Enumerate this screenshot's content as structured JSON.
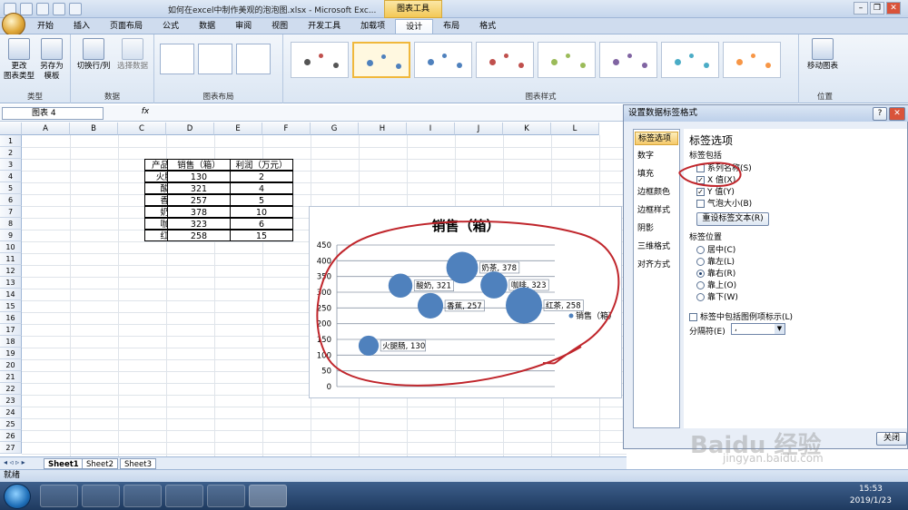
{
  "window": {
    "title": "如何在excel中制作美观的泡泡图.xlsx - Microsoft Exc...",
    "chart_tools_label": "图表工具"
  },
  "ribbon_tabs": [
    "开始",
    "插入",
    "页面布局",
    "公式",
    "数据",
    "审阅",
    "视图",
    "开发工具",
    "加载项",
    "设计",
    "布局",
    "格式"
  ],
  "active_tab": "设计",
  "ribbon": {
    "group_type": {
      "label": "类型",
      "btn_change": "更改\n图表类型",
      "btn_saveas": "另存为\n模板"
    },
    "group_data": {
      "label": "数据",
      "btn_switch": "切换行/列",
      "btn_select": "选择数据"
    },
    "group_layout": {
      "label": "图表布局"
    },
    "group_styles": {
      "label": "图表样式"
    },
    "group_location": {
      "label": "位置",
      "btn_move": "移动图表"
    }
  },
  "name_box": "图表 4",
  "fx_label": "fx",
  "columns": [
    "A",
    "B",
    "C",
    "D",
    "E",
    "F",
    "G",
    "H",
    "I",
    "J",
    "K",
    "L"
  ],
  "rows": [
    "1",
    "2",
    "3",
    "4",
    "5",
    "6",
    "7",
    "8",
    "9",
    "10",
    "11",
    "12",
    "13",
    "14",
    "15",
    "16",
    "17",
    "18",
    "19",
    "20",
    "21",
    "22",
    "23",
    "24",
    "25",
    "26",
    "27"
  ],
  "table": {
    "headers": [
      "产品名称",
      "销售（箱）",
      "利润（万元）"
    ],
    "rows": [
      [
        "火腿肠",
        "130",
        "2"
      ],
      [
        "酸奶",
        "321",
        "4"
      ],
      [
        "香蕉",
        "257",
        "5"
      ],
      [
        "奶茶",
        "378",
        "10"
      ],
      [
        "咖啡",
        "323",
        "6"
      ],
      [
        "红茶",
        "258",
        "15"
      ]
    ]
  },
  "chart_data": {
    "type": "scatter",
    "title": "销售（箱）",
    "ylim": [
      0,
      450
    ],
    "yticks": [
      "0",
      "50",
      "100",
      "150",
      "200",
      "250",
      "300",
      "350",
      "400",
      "450"
    ],
    "legend": "销售（箱）",
    "legend_position": "right",
    "grid": true,
    "points": [
      {
        "label": "火腿肠, 130",
        "y": 130,
        "size": 2
      },
      {
        "label": "酸奶, 321",
        "y": 321,
        "size": 4
      },
      {
        "label": "香蕉, 257",
        "y": 257,
        "size": 5
      },
      {
        "label": "奶茶, 378",
        "y": 378,
        "size": 10
      },
      {
        "label": "咖啡, 323",
        "y": 323,
        "size": 6
      },
      {
        "label": "红茶, 258",
        "y": 258,
        "size": 15
      }
    ],
    "color": "#4f81bd"
  },
  "sheet_tabs": [
    "Sheet1",
    "Sheet2",
    "Sheet3"
  ],
  "status": "就绪",
  "dialog": {
    "title": "设置数据标签格式",
    "nav": [
      "标签选项",
      "数字",
      "填充",
      "边框颜色",
      "边框样式",
      "阴影",
      "三维格式",
      "对齐方式"
    ],
    "selected_nav": "标签选项",
    "section_title": "标签选项",
    "contains_label": "标签包括",
    "checkboxes": [
      {
        "label": "系列名称(S)",
        "checked": false
      },
      {
        "label": "X 值(X)",
        "checked": true
      },
      {
        "label": "Y 值(Y)",
        "checked": true
      },
      {
        "label": "气泡大小(B)",
        "checked": false
      }
    ],
    "reset_btn": "重设标签文本(R)",
    "position_label": "标签位置",
    "positions": [
      {
        "label": "居中(C)",
        "selected": false
      },
      {
        "label": "靠左(L)",
        "selected": false
      },
      {
        "label": "靠右(R)",
        "selected": true
      },
      {
        "label": "靠上(O)",
        "selected": false
      },
      {
        "label": "靠下(W)",
        "selected": false
      }
    ],
    "legend_key_label": "标签中包括图例项标示(L)",
    "separator_label": "分隔符(E)",
    "separator_value": ",",
    "close_btn": "关闭"
  },
  "taskbar": {
    "time": "15:53",
    "date": "2019/1/23"
  },
  "watermark": "Bai 经验 jingyan.baidu.com"
}
